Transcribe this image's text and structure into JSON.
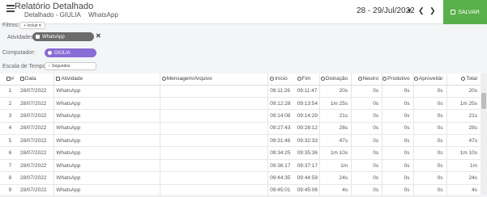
{
  "header": {
    "title": "Relatório Detalhado",
    "subtitle": "Detalhado - GIULIA",
    "subtitle_app": "WhatsApp",
    "date_range": "28 - 29/Jul/2022",
    "prev": "❮",
    "next": "❯",
    "calendar": "▾",
    "save_label": "SALVAR"
  },
  "filters": {
    "label": "Filtros:",
    "add_label": "+ Incluir ▾",
    "atividades_label": "Atividades:",
    "atividades_value": "WhatsApp",
    "computador_label": "Computador:",
    "computador_value": "GIULIA",
    "escala_label": "Escala de Tempo:",
    "escala_value": "Segundos"
  },
  "table": {
    "headers": {
      "num": "#",
      "data": "Data",
      "atividade": "Atividade",
      "mensagem": "Mensagem/Arquivo",
      "inicio": "Início",
      "fim": "Fim",
      "distracao": "Distração",
      "neutro": "Neutro",
      "produtivo": "Produtivo",
      "aproveitar": "Aproveitár",
      "total": "Total"
    },
    "rows": [
      {
        "num": "1",
        "data": "28/07/2022",
        "atividade": "WhatsApp",
        "mensagem": "",
        "inicio": "09:11:26",
        "fim": "09:11:47",
        "distracao": "20s",
        "neutro": "0s",
        "produtivo": "0s",
        "aproveitar": "0s",
        "total": "20s"
      },
      {
        "num": "2",
        "data": "28/07/2022",
        "atividade": "WhatsApp",
        "mensagem": "",
        "inicio": "09:12:28",
        "fim": "09:13:54",
        "distracao": "1m 25s",
        "neutro": "0s",
        "produtivo": "0s",
        "aproveitar": "0s",
        "total": "1m 25s"
      },
      {
        "num": "3",
        "data": "28/07/2022",
        "atividade": "WhatsApp",
        "mensagem": "",
        "inicio": "09:14:08",
        "fim": "09:14:29",
        "distracao": "21s",
        "neutro": "0s",
        "produtivo": "0s",
        "aproveitar": "0s",
        "total": "21s"
      },
      {
        "num": "4",
        "data": "28/07/2022",
        "atividade": "WhatsApp",
        "mensagem": "",
        "inicio": "09:27:43",
        "fim": "09:28:12",
        "distracao": "28s",
        "neutro": "0s",
        "produtivo": "0s",
        "aproveitar": "0s",
        "total": "28s"
      },
      {
        "num": "5",
        "data": "28/07/2022",
        "atividade": "WhatsApp",
        "mensagem": "",
        "inicio": "09:31:46",
        "fim": "09:32:33",
        "distracao": "47s",
        "neutro": "0s",
        "produtivo": "0s",
        "aproveitar": "0s",
        "total": "47s"
      },
      {
        "num": "6",
        "data": "28/07/2022",
        "atividade": "WhatsApp",
        "mensagem": "",
        "inicio": "09:34:25",
        "fim": "09:35:36",
        "distracao": "1m 10s",
        "neutro": "0s",
        "produtivo": "0s",
        "aproveitar": "0s",
        "total": "1m 10s"
      },
      {
        "num": "7",
        "data": "28/07/2022",
        "atividade": "WhatsApp",
        "mensagem": "",
        "inicio": "09:36:17",
        "fim": "09:37:17",
        "distracao": "1m",
        "neutro": "0s",
        "produtivo": "0s",
        "aproveitar": "0s",
        "total": "1m"
      },
      {
        "num": "8",
        "data": "28/07/2022",
        "atividade": "WhatsApp",
        "mensagem": "",
        "inicio": "09:44:35",
        "fim": "09:44:59",
        "distracao": "24s",
        "neutro": "0s",
        "produtivo": "0s",
        "aproveitar": "0s",
        "total": "24s"
      },
      {
        "num": "9",
        "data": "28/07/2022",
        "atividade": "WhatsApp",
        "mensagem": "",
        "inicio": "09:45:01",
        "fim": "09:45:06",
        "distracao": "4s",
        "neutro": "0s",
        "produtivo": "0s",
        "aproveitar": "0s",
        "total": "4s"
      }
    ]
  },
  "colors": {
    "save": "#58b04a",
    "computer_chip": "#8a6cd6",
    "activity_chip": "#6b6b6b"
  }
}
